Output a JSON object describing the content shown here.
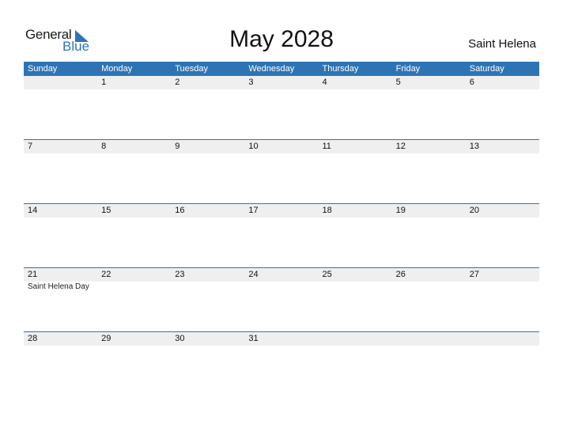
{
  "logo": {
    "general": "General",
    "blue": "Blue"
  },
  "title": "May 2028",
  "country": "Saint Helena",
  "colors": {
    "accent": "#2e74b5",
    "strip": "#efefef"
  },
  "weekdays": [
    "Sunday",
    "Monday",
    "Tuesday",
    "Wednesday",
    "Thursday",
    "Friday",
    "Saturday"
  ],
  "weeks": [
    {
      "days": [
        "",
        "1",
        "2",
        "3",
        "4",
        "5",
        "6"
      ],
      "events": [
        "",
        "",
        "",
        "",
        "",
        "",
        ""
      ]
    },
    {
      "days": [
        "7",
        "8",
        "9",
        "10",
        "11",
        "12",
        "13"
      ],
      "events": [
        "",
        "",
        "",
        "",
        "",
        "",
        ""
      ]
    },
    {
      "days": [
        "14",
        "15",
        "16",
        "17",
        "18",
        "19",
        "20"
      ],
      "events": [
        "",
        "",
        "",
        "",
        "",
        "",
        ""
      ]
    },
    {
      "days": [
        "21",
        "22",
        "23",
        "24",
        "25",
        "26",
        "27"
      ],
      "events": [
        "Saint Helena Day",
        "",
        "",
        "",
        "",
        "",
        ""
      ]
    },
    {
      "days": [
        "28",
        "29",
        "30",
        "31",
        "",
        "",
        ""
      ],
      "events": [
        "",
        "",
        "",
        "",
        "",
        "",
        ""
      ]
    }
  ]
}
